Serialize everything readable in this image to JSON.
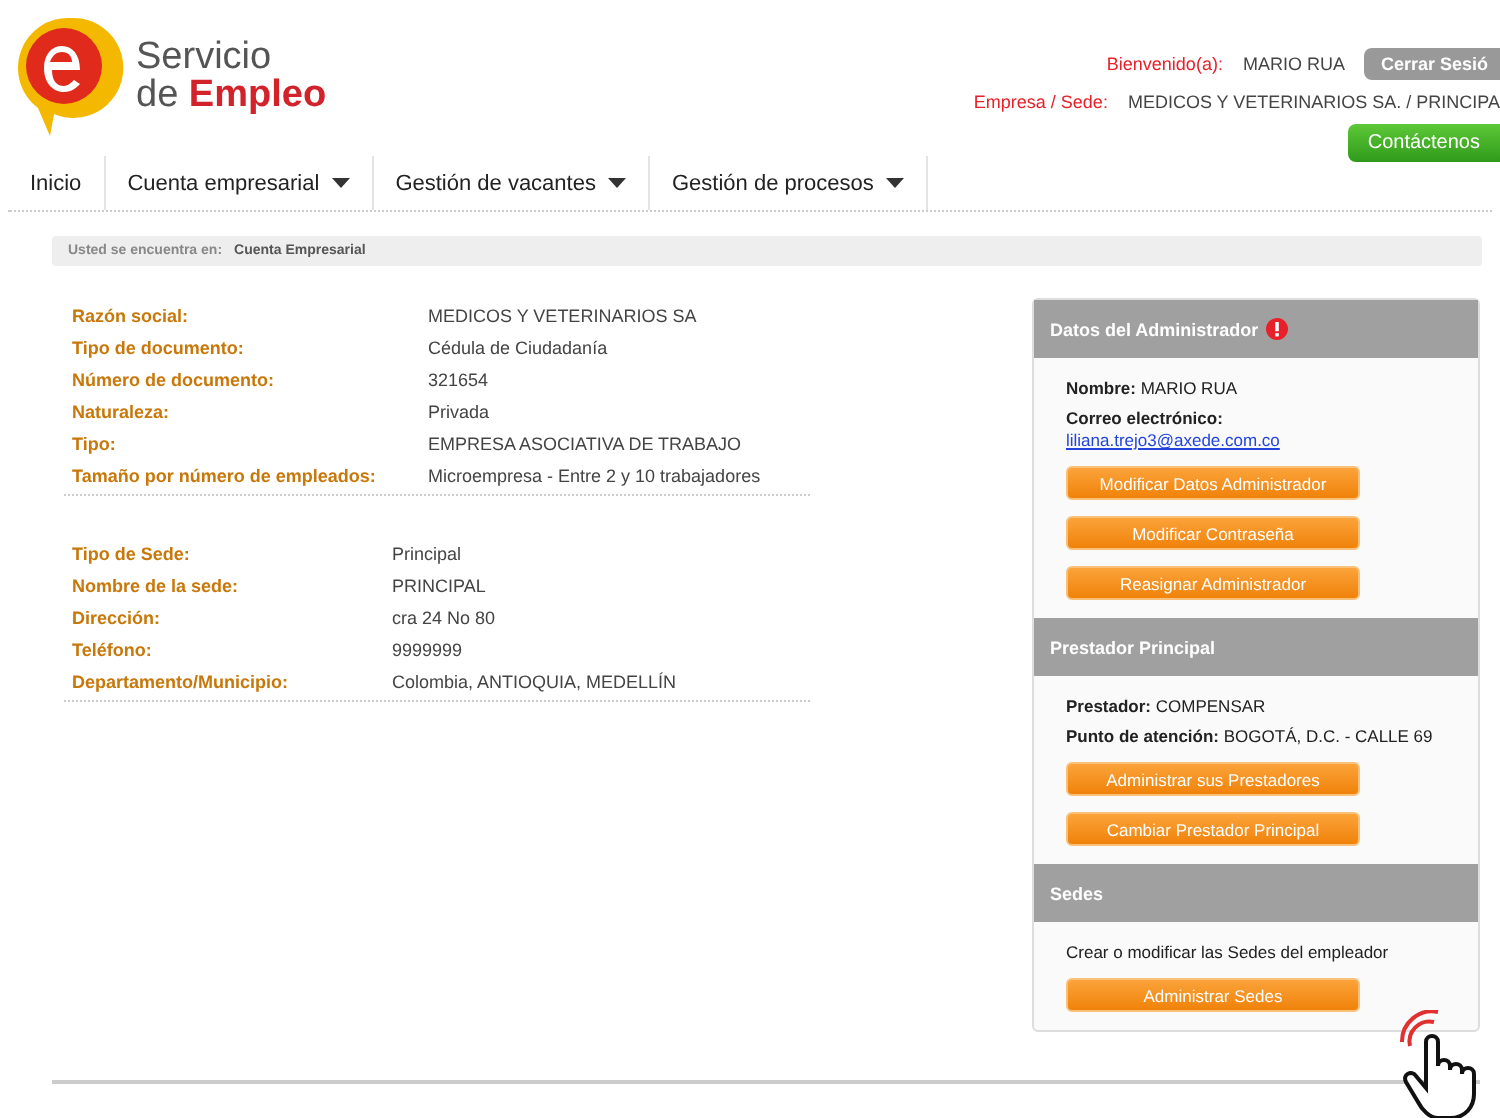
{
  "brand": {
    "line1": "Servicio",
    "line2_lead": "de",
    "line2_accent": "Empleo"
  },
  "user_bar": {
    "welcome_label": "Bienvenido(a):",
    "user_name": "MARIO RUA",
    "logout": "Cerrar Sesió",
    "company_label": "Empresa / Sede:",
    "company_value": "MEDICOS Y VETERINARIOS SA. / PRINCIPA",
    "contact": "Contáctenos"
  },
  "nav": [
    {
      "label": "Inicio",
      "dropdown": false
    },
    {
      "label": "Cuenta empresarial",
      "dropdown": true
    },
    {
      "label": "Gestión de vacantes",
      "dropdown": true
    },
    {
      "label": "Gestión de procesos",
      "dropdown": true
    }
  ],
  "breadcrumb": {
    "label": "Usted se encuentra en:",
    "current": "Cuenta Empresarial"
  },
  "company_fields": [
    {
      "label": "Razón social:",
      "value": "MEDICOS Y VETERINARIOS SA"
    },
    {
      "label": "Tipo de documento:",
      "value": "Cédula de Ciudadanía"
    },
    {
      "label": "Número de documento:",
      "value": "321654"
    },
    {
      "label": "Naturaleza:",
      "value": "Privada"
    },
    {
      "label": "Tipo:",
      "value": "EMPRESA ASOCIATIVA DE TRABAJO"
    },
    {
      "label": "Tamaño por número de empleados:",
      "value": "Microempresa - Entre 2 y 10 trabajadores"
    }
  ],
  "site_fields": [
    {
      "label": "Tipo de Sede:",
      "value": "Principal"
    },
    {
      "label": "Nombre de la sede:",
      "value": "PRINCIPAL"
    },
    {
      "label": "Dirección:",
      "value": "cra 24 No 80"
    },
    {
      "label": "Teléfono:",
      "value": "9999999"
    },
    {
      "label": "Departamento/Municipio:",
      "value": "Colombia, ANTIOQUIA, MEDELLÍN"
    }
  ],
  "panels": [
    {
      "title": "Datos del Administrador",
      "alert": true,
      "lines": [
        {
          "label": "Nombre:",
          "value": "MARIO RUA"
        },
        {
          "label": "Correo electrónico:",
          "link": "liliana.trejo3@axede.com.co"
        }
      ],
      "buttons": [
        "Modificar Datos Administrador",
        "Modificar Contraseña",
        "Reasignar Administrador"
      ]
    },
    {
      "title": "Prestador Principal",
      "alert": false,
      "lines": [
        {
          "label": "Prestador:",
          "value": "COMPENSAR"
        },
        {
          "label": "Punto de atención:",
          "value": "BOGOTÁ, D.C. - CALLE 69"
        }
      ],
      "buttons": [
        "Administrar sus Prestadores",
        "Cambiar Prestador Principal"
      ]
    },
    {
      "title": "Sedes",
      "alert": false,
      "lines": [
        {
          "text": "Crear o modificar las Sedes del empleador"
        }
      ],
      "buttons": [
        "Administrar Sedes"
      ]
    }
  ]
}
